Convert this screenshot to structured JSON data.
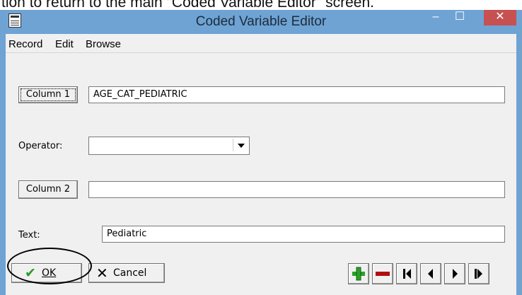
{
  "document": {
    "caption_fragment": "tion to return to the main \"Coded Variable Editor\" screen."
  },
  "window": {
    "title": "Coded Variable Editor",
    "minimize_glyph": "–",
    "maximize_glyph": "☐",
    "close_glyph": "✕"
  },
  "menu": [
    "Record",
    "Edit",
    "Browse"
  ],
  "form": {
    "column1_button": "Column 1",
    "column1_value": "AGE_CAT_PEDIATRIC",
    "operator_label": "Operator:",
    "operator_value": "",
    "column2_button": "Column 2",
    "column2_value": "",
    "text_label": "Text:",
    "text_value": "Pediatric"
  },
  "buttons": {
    "ok_label": "OK",
    "cancel_label": "Cancel",
    "add_icon": "plus-icon",
    "delete_icon": "minus-icon",
    "first_icon": "first-record-icon",
    "prev_icon": "previous-record-icon",
    "next_icon": "next-record-icon",
    "last_icon": "last-record-icon"
  },
  "colors": {
    "titlebar": "#6ea3d4",
    "close_button": "#c75050",
    "ok_check": "#2a9a2a",
    "plus": "#2aa02a",
    "minus": "#b01010"
  }
}
